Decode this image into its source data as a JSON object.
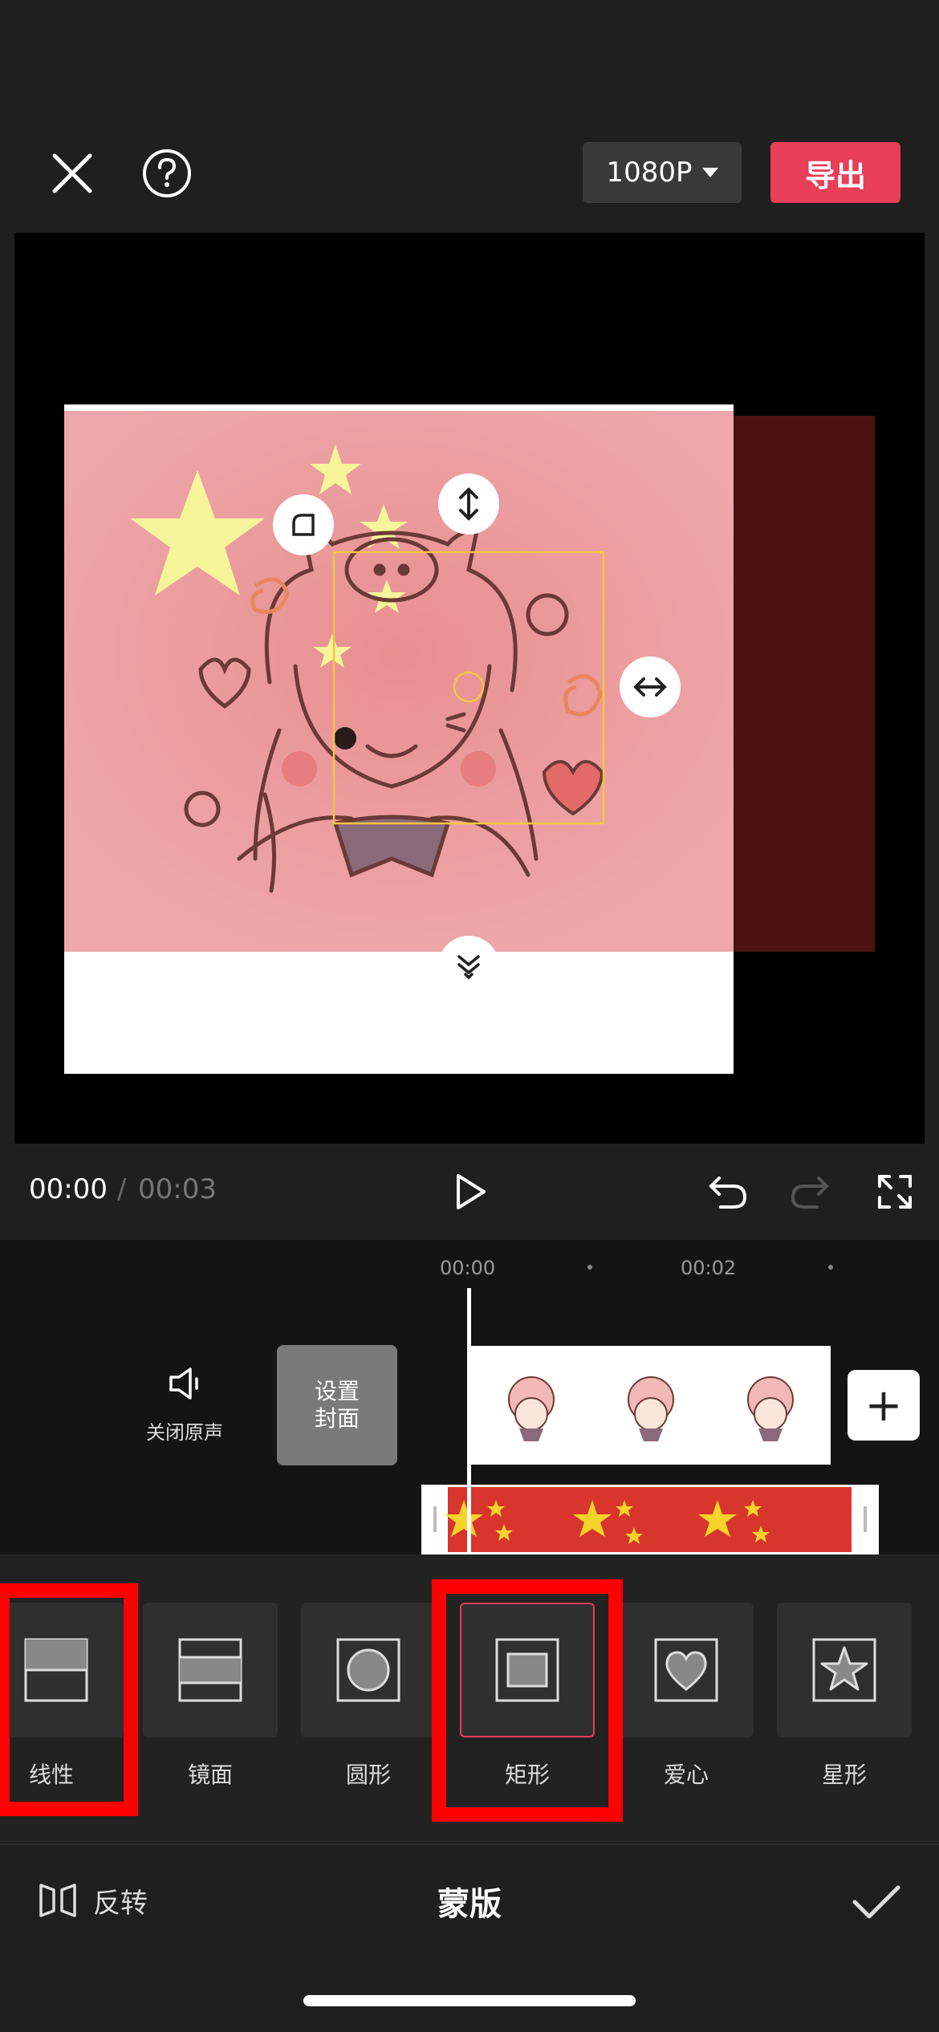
{
  "topbar": {
    "resolution_label": "1080P",
    "export_label": "导出"
  },
  "playback": {
    "current_time": "00:00",
    "separator": "/",
    "total_time": "00:03"
  },
  "timeline": {
    "ruler": [
      "00:00",
      "00:02"
    ],
    "mute_label": "关闭原声",
    "cover_label_line1": "设置",
    "cover_label_line2": "封面",
    "add_label": "+"
  },
  "masks": [
    {
      "label": "线性",
      "icon": "linear-mask-icon"
    },
    {
      "label": "镜面",
      "icon": "mirror-mask-icon"
    },
    {
      "label": "圆形",
      "icon": "circle-mask-icon"
    },
    {
      "label": "矩形",
      "icon": "rectangle-mask-icon",
      "selected": true
    },
    {
      "label": "爱心",
      "icon": "heart-mask-icon"
    },
    {
      "label": "星形",
      "icon": "star-mask-icon"
    }
  ],
  "bottom": {
    "reverse_label": "反转",
    "title": "蒙版"
  },
  "colors": {
    "accent": "#e83e58",
    "highlight": "#ff0000",
    "mask_frame": "#f5c542"
  }
}
